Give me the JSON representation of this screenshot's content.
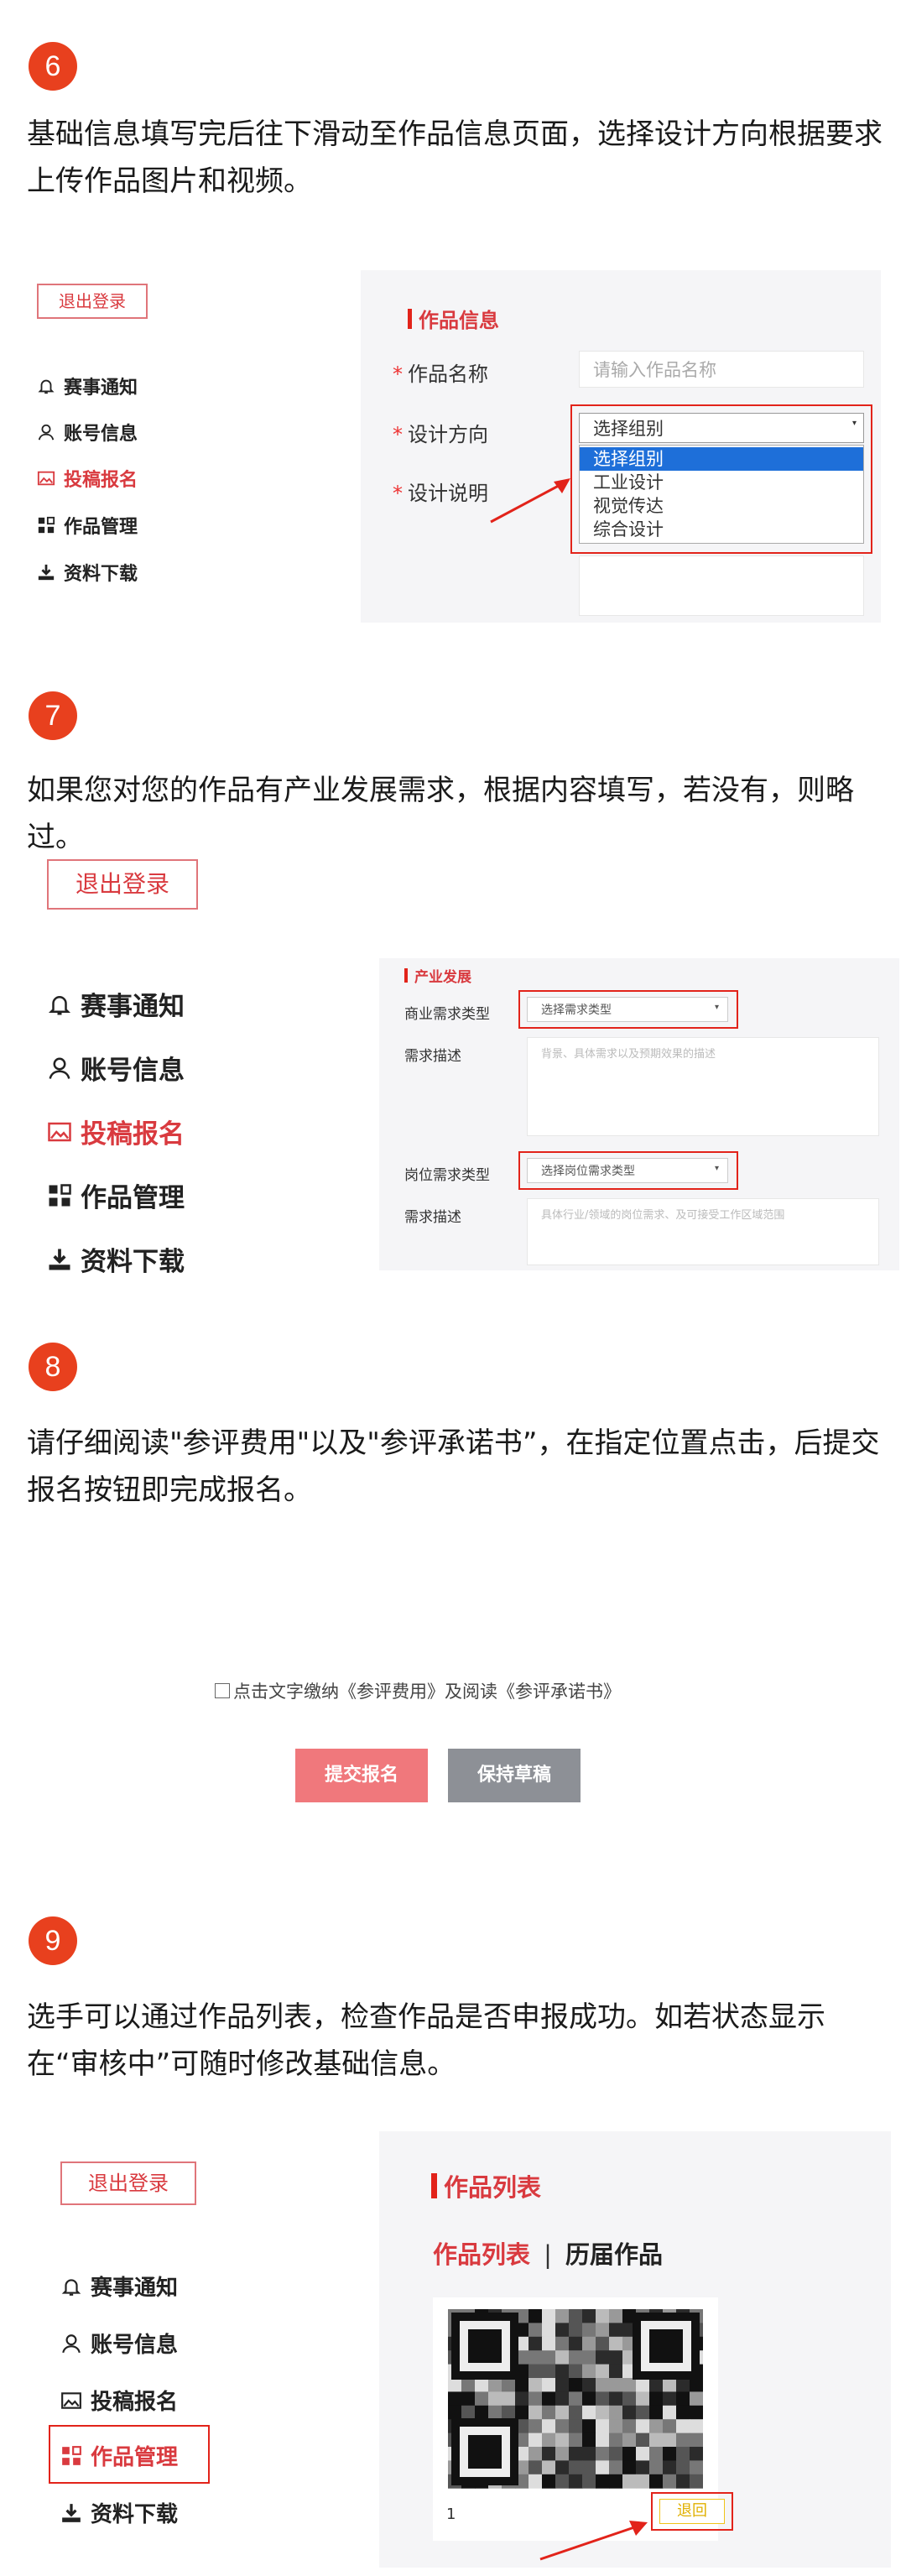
{
  "steps": [
    {
      "number": "6",
      "text": "基础信息填写完后往下滑动至作品信息页面，选择设计方向根据要求上传作品图片和视频。"
    },
    {
      "number": "7",
      "text": "如果您对您的作品有产业发展需求，根据内容填写，若没有，则略过。"
    },
    {
      "number": "8",
      "text": "请仔细阅读\"参评费用\"以及\"参评承诺书”，在指定位置点击，后提交报名按钮即完成报名。"
    },
    {
      "number": "9",
      "text": "选手可以通过作品列表，检查作品是否申报成功。如若状态显示在“审核中”可随时修改基础信息。"
    }
  ],
  "sidebar": {
    "logout_label": "退出登录",
    "items": [
      {
        "label": "赛事通知",
        "icon": "bell-icon"
      },
      {
        "label": "账号信息",
        "icon": "user-icon"
      },
      {
        "label": "投稿报名",
        "icon": "image-icon"
      },
      {
        "label": "作品管理",
        "icon": "grid-icon"
      },
      {
        "label": "资料下载",
        "icon": "download-icon"
      }
    ]
  },
  "shot1": {
    "section_title": "作品信息",
    "name_label": "作品名称",
    "name_placeholder": "请输入作品名称",
    "direction_label": "设计方向",
    "direction_selected": "选择组别",
    "direction_options": [
      "选择组别",
      "工业设计",
      "视觉传达",
      "综合设计"
    ],
    "desc_label": "设计说明"
  },
  "shot2": {
    "section_title": "产业发展",
    "biz_type_label": "商业需求类型",
    "biz_type_value": "选择需求类型",
    "biz_desc_label": "需求描述",
    "biz_desc_placeholder": "背景、具体需求以及预期效果的描述",
    "job_type_label": "岗位需求类型",
    "job_type_value": "选择岗位需求类型",
    "job_desc_label": "需求描述",
    "job_desc_placeholder": "具体行业/领域的岗位需求、及可接受工作区域范围"
  },
  "shot3": {
    "agree_text": "点击文字缴纳《参评费用》及阅读《参评承诺书》",
    "submit_label": "提交报名",
    "draft_label": "保持草稿"
  },
  "shot4": {
    "section_title": "作品列表",
    "tab_active": "作品列表",
    "tab_separator": "|",
    "tab_other": "历届作品",
    "item_index": "1",
    "return_label": "退回"
  },
  "colors": {
    "accent": "#e2231a",
    "step_badge": "#e8401e",
    "submit": "#f0787c",
    "draft": "#8d9096",
    "panel": "#f5f5f7"
  }
}
